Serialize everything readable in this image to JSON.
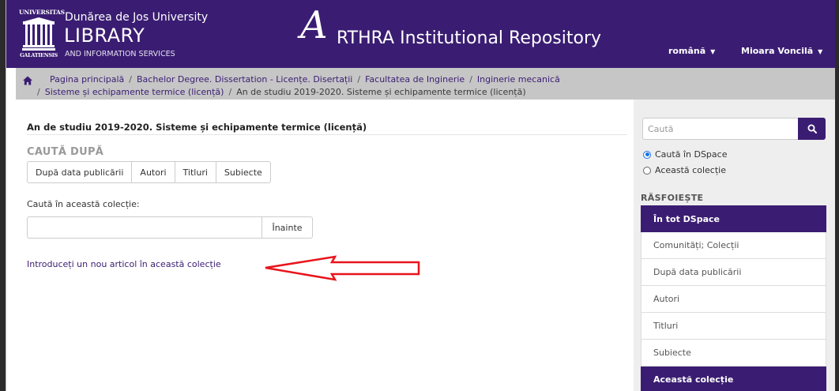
{
  "header": {
    "logo_top": "UNIVERSITAS",
    "logo_bottom": "GALATIENSIS",
    "university_name": "Dunărea de Jos University",
    "library": "LIBRARY",
    "services": "AND INFORMATION SERVICES",
    "repo_letter": "A",
    "repo_title": "RTHRA Institutional Repository",
    "language": "română",
    "user": "Mioara Voncilă"
  },
  "breadcrumb": {
    "items": [
      "Pagina principală",
      "Bachelor Degree. Dissertation - Licențe. Disertații",
      "Facultatea de Inginerie",
      "Inginerie mecanică",
      "Sisteme și echipamente termice (licență)",
      "An de studiu 2019-2020. Sisteme și echipamente termice (licență)"
    ]
  },
  "main": {
    "title": "An de studiu 2019-2020. Sisteme și echipamente termice (licență)",
    "browse_heading": "CAUTĂ DUPĂ",
    "browse_buttons": [
      "După data publicării",
      "Autori",
      "Titluri",
      "Subiecte"
    ],
    "search_label": "Caută în această colecție:",
    "search_value": "",
    "search_button": "Înainte",
    "submit_link": "Introduceți un nou articol în această colecție"
  },
  "sidebar": {
    "search_placeholder": "Caută",
    "scope_options": [
      {
        "label": "Caută în DSpace",
        "checked": true
      },
      {
        "label": "Această colecție",
        "checked": false
      }
    ],
    "browse_heading": "RĂSFOIEȘTE",
    "all_dspace": "În tot DSpace",
    "items": [
      "Comunități; Colecții",
      "După data publicării",
      "Autori",
      "Titluri",
      "Subiecte"
    ],
    "this_collection": "Această colecție"
  },
  "colors": {
    "brand": "#3a1d72",
    "annotation_arrow": "#e8141b"
  }
}
